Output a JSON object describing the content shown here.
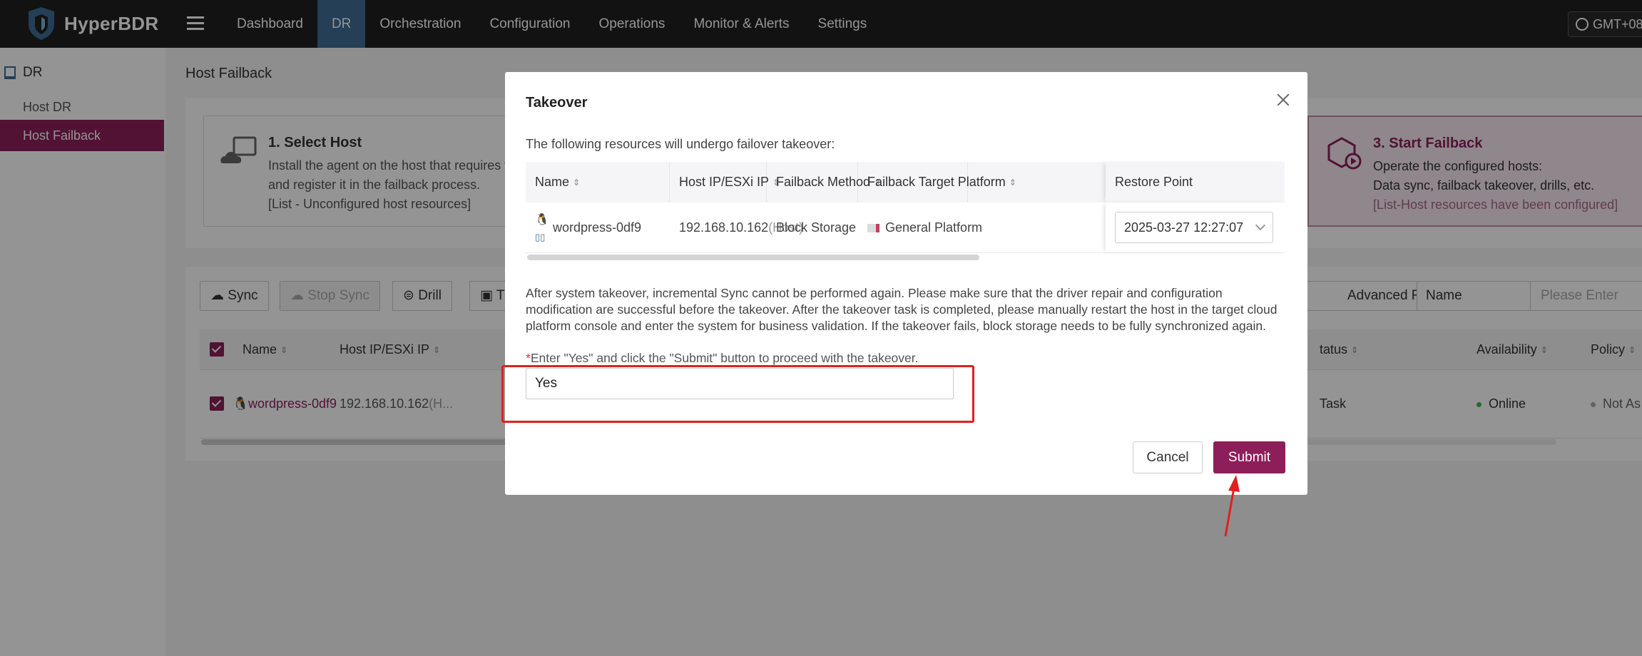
{
  "app": {
    "name": "HyperBDR",
    "timezone": "GMT+08"
  },
  "nav": {
    "items": [
      {
        "label": "Dashboard",
        "active": false
      },
      {
        "label": "DR",
        "active": true
      },
      {
        "label": "Orchestration",
        "active": false
      },
      {
        "label": "Configuration",
        "active": false
      },
      {
        "label": "Operations",
        "active": false
      },
      {
        "label": "Monitor & Alerts",
        "active": false
      },
      {
        "label": "Settings",
        "active": false
      }
    ]
  },
  "sidebar": {
    "section": "DR",
    "items": [
      {
        "label": "Host DR",
        "active": false
      },
      {
        "label": "Host Failback",
        "active": true
      }
    ]
  },
  "page": {
    "title": "Host Failback",
    "steps": [
      {
        "title": "1. Select Host",
        "desc": "Install the agent on the host that requires fa\nand register it in the failback process.\n[List - Unconfigured host resources]"
      },
      {
        "title": "3. Start Failback",
        "desc": "Operate the configured hosts:\nData sync, failback takeover, drills, etc.",
        "note": "[List-Host resources have been configured]"
      }
    ],
    "toolbar": {
      "sync": "Sync",
      "stop_sync": "Stop Sync",
      "drill": "Drill",
      "t_button": "T",
      "advanced_filter": "Advanced Filter",
      "filter_field": "Name",
      "search_placeholder": "Please Enter"
    },
    "table": {
      "headers": {
        "name": "Name",
        "ip": "Host IP/ESXi IP",
        "status": "tatus",
        "availability": "Availability",
        "policy": "Policy"
      },
      "rows": [
        {
          "name": "wordpress-0df9",
          "ip": "192.168.10.162",
          "ip_suffix": "(H...",
          "status": "Task",
          "availability": "Online",
          "policy": "Not As"
        }
      ]
    }
  },
  "modal": {
    "title": "Takeover",
    "intro": "The following resources will undergo failover takeover:",
    "columns": [
      "Name",
      "Host IP/ESXi IP",
      "Failback Method",
      "Failback Target Platform",
      "Restore Point"
    ],
    "row": {
      "name": "wordpress-0df9",
      "ip": "192.168.10.162",
      "ip_tag": "(Host)",
      "method": "Block Storage",
      "platform": "General Platform",
      "restore_point": "2025-03-27 12:27:07"
    },
    "warning": "After system takeover, incremental Sync cannot be performed again. Please make sure that the driver repair and configuration modification are successful before the takeover. After the takeover task is completed, please manually restart the host in the target cloud platform console and enter the system for business validation. If the takeover fails, block storage needs to be fully synchronized again.",
    "prompt_required_mark": "*",
    "prompt": "Enter \"Yes\" and click the \"Submit\" button to proceed with the takeover.",
    "input_value": "Yes",
    "cancel_label": "Cancel",
    "submit_label": "Submit"
  },
  "colors": {
    "accent": "#8c1f5a",
    "nav_active": "#3e6d95",
    "highlight": "#e02020"
  }
}
